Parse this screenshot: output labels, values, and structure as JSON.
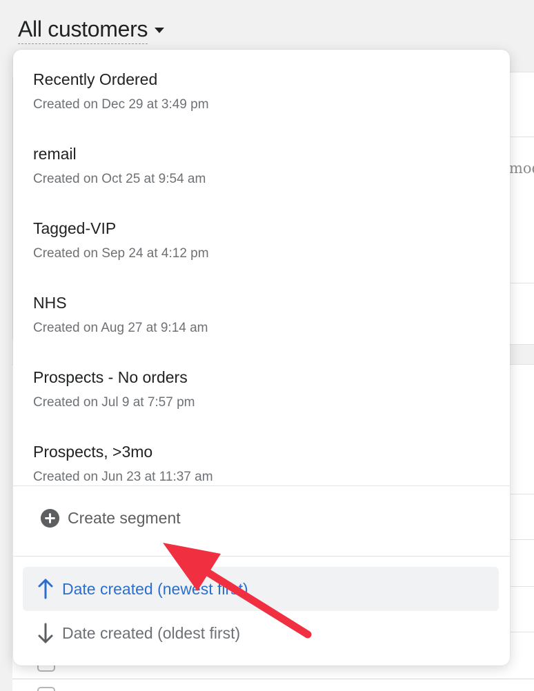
{
  "header": {
    "title": "All customers"
  },
  "background": {
    "partial_text": "mod"
  },
  "segments": [
    {
      "name": "Recently Ordered",
      "created": "Created on Dec 29 at 3:49 pm"
    },
    {
      "name": "remail",
      "created": "Created on Oct 25 at 9:54 am"
    },
    {
      "name": "Tagged-VIP",
      "created": "Created on Sep 24 at 4:12 pm"
    },
    {
      "name": "NHS",
      "created": "Created on Aug 27 at 9:14 am"
    },
    {
      "name": "Prospects - No orders",
      "created": "Created on Jul 9 at 7:57 pm"
    },
    {
      "name": "Prospects, >3mo",
      "created": "Created on Jun 23 at 11:37 am"
    }
  ],
  "actions": {
    "create_segment": "Create segment",
    "create_icon": "plus-circle-icon"
  },
  "sort": {
    "options": [
      {
        "label": "Date created (newest first)",
        "icon": "arrow-up-icon",
        "selected": true
      },
      {
        "label": "Date created (oldest first)",
        "icon": "arrow-down-icon",
        "selected": false
      }
    ]
  },
  "colors": {
    "accent": "#2c6ecb",
    "annotation": "#f03040",
    "text_primary": "#202223",
    "text_secondary": "#6d7175"
  }
}
